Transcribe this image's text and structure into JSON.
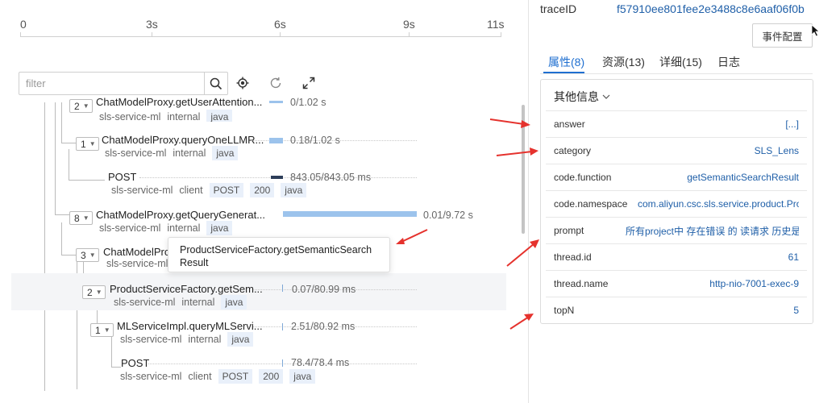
{
  "timeline": {
    "ticks": [
      "0",
      "3s",
      "6s",
      "9s",
      "11s"
    ]
  },
  "toolbar": {
    "filter_placeholder": "filter"
  },
  "spans": [
    {
      "count": "2",
      "name": "ChatModelProxy.getUserAttention...",
      "service": "sls-service-ml",
      "kind": "internal",
      "tags": [
        "java"
      ],
      "time": "0/1.02 s"
    },
    {
      "count": "1",
      "name": "ChatModelProxy.queryOneLLMR...",
      "service": "sls-service-ml",
      "kind": "internal",
      "tags": [
        "java"
      ],
      "time": "0.18/1.02 s"
    },
    {
      "count": "",
      "name": "POST",
      "service": "sls-service-ml",
      "kind": "client",
      "tags": [
        "POST",
        "200",
        "java"
      ],
      "time": "843.05/843.05 ms"
    },
    {
      "count": "8",
      "name": "ChatModelProxy.getQueryGenerat...",
      "service": "sls-service-ml",
      "kind": "internal",
      "tags": [
        "java"
      ],
      "time": "0.01/9.72 s"
    },
    {
      "count": "3",
      "name": "ChatModelProxy...",
      "service": "sls-service-ml",
      "kind": "internal",
      "tags": [
        "java"
      ],
      "time": ""
    },
    {
      "count": "2",
      "name": "ProductServiceFactory.getSem...",
      "service": "sls-service-ml",
      "kind": "internal",
      "tags": [
        "java"
      ],
      "time": "0.07/80.99 ms"
    },
    {
      "count": "1",
      "name": "MLServiceImpl.queryMLServi...",
      "service": "sls-service-ml",
      "kind": "internal",
      "tags": [
        "java"
      ],
      "time": "2.51/80.92 ms"
    },
    {
      "count": "",
      "name": "POST",
      "service": "sls-service-ml",
      "kind": "client",
      "tags": [
        "POST",
        "200",
        "java"
      ],
      "time": "78.4/78.4 ms"
    }
  ],
  "tooltip": {
    "text": "ProductServiceFactory.getSemanticSearchResult"
  },
  "detail": {
    "trace_label": "traceID",
    "trace_id": "f57910ee801fee2e3488c8e6aaf06f0b",
    "event_button": "事件配置",
    "tabs": [
      "属性(8)",
      "资源(13)",
      "详细(15)",
      "日志"
    ],
    "section_title": "其他信息",
    "attributes": [
      {
        "key": "answer",
        "value": "[...]"
      },
      {
        "key": "category",
        "value": "SLS_Lens"
      },
      {
        "key": "code.function",
        "value": "getSemanticSearchResult"
      },
      {
        "key": "code.namespace",
        "value": "com.aliyun.csc.sls.service.product.Pro"
      },
      {
        "key": "prompt",
        "value": "所有project中 存在错误 的 读请求 历史是什么?"
      },
      {
        "key": "thread.id",
        "value": "61"
      },
      {
        "key": "thread.name",
        "value": "http-nio-7001-exec-9"
      },
      {
        "key": "topN",
        "value": "5"
      }
    ]
  },
  "colors": {
    "accent": "#1f6fd0",
    "link": "#1f5fa8",
    "bar": "#9cc3ec",
    "annotation_arrow": "#e5322d"
  }
}
